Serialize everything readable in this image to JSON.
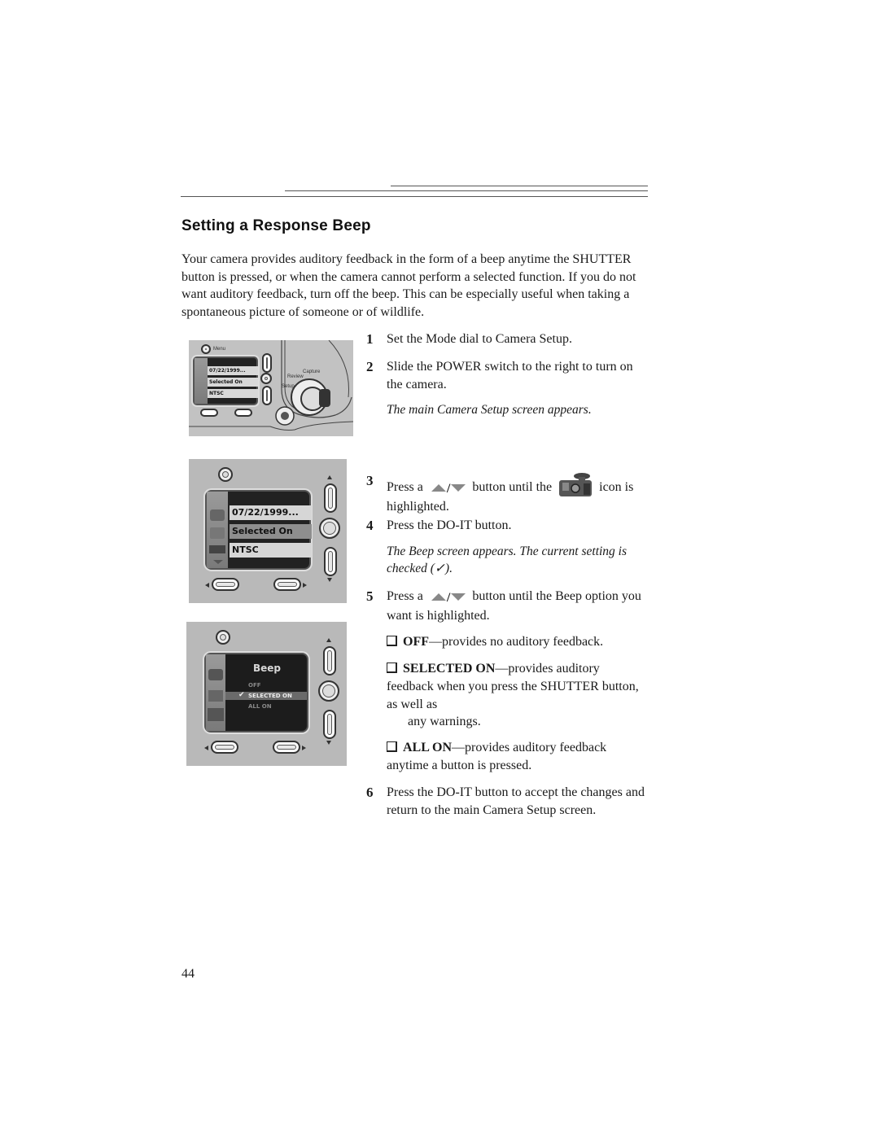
{
  "page": {
    "title": "Setting a Response Beep",
    "intro": "Your camera provides auditory feedback in the form of a beep anytime the SHUTTER button is pressed, or when the camera cannot perform a selected function. If you do not want auditory feedback, turn off the beep. This can be especially useful when taking a spontaneous picture of someone or of wildlife.",
    "page_number": "44"
  },
  "steps": [
    {
      "num": "1",
      "text": "Set the Mode dial to Camera Setup."
    },
    {
      "num": "2",
      "text": "Slide the POWER switch to the right to turn on the camera.",
      "note": "The main Camera Setup screen appears."
    },
    {
      "num": "3",
      "text_before": "Press a",
      "text_middle": "button until the",
      "text_after": "icon is highlighted."
    },
    {
      "num": "4",
      "text": "Press the DO-IT button.",
      "note": "The Beep screen appears. The current setting is checked (✓)."
    },
    {
      "num": "5",
      "text_before": "Press a",
      "text_after": "button until the Beep option you want is highlighted."
    },
    {
      "num": "6",
      "text": "Press the DO-IT button to accept the changes and return to the main Camera Setup screen."
    }
  ],
  "options": [
    {
      "label": "OFF",
      "desc": "—provides no auditory feedback."
    },
    {
      "label": "SELECTED ON",
      "desc": "—provides auditory feedback when you press the SHUTTER button, as well as",
      "desc2": "any warnings."
    },
    {
      "label": "ALL ON",
      "desc": "—provides auditory feedback anytime a button is pressed."
    }
  ],
  "figures": {
    "camera_back": {
      "menu_label": "Menu",
      "rows": [
        "07/22/1999...",
        "Selected On",
        "NTSC"
      ],
      "dial_labels": [
        "Capture",
        "Review",
        "Setup"
      ]
    },
    "setup_screen": {
      "rows": [
        "07/22/1999...",
        "Selected On",
        "NTSC"
      ],
      "highlighted_row": "Selected On"
    },
    "beep_screen": {
      "heading": "Beep",
      "options": [
        "OFF",
        "SELECTED ON",
        "ALL ON"
      ],
      "checked": "SELECTED ON",
      "check_glyph": "✔"
    }
  }
}
